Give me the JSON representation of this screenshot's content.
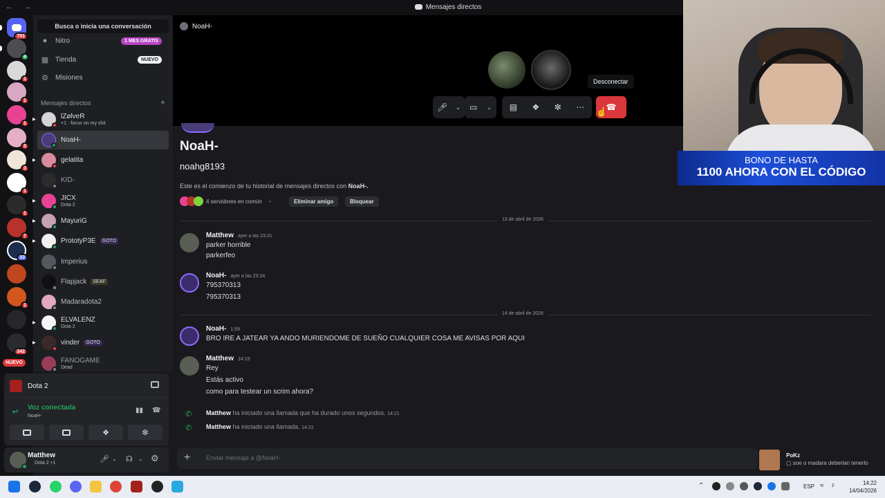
{
  "window": {
    "title": "Mensajes directos"
  },
  "sidebar": {
    "search_placeholder": "Busca o inicia una conversación",
    "nav": [
      {
        "label": "Nitro",
        "pill": "1 MES GRATIS"
      },
      {
        "label": "Tienda",
        "pill": "NUEVO"
      },
      {
        "label": "Misiones",
        "pill": ""
      }
    ],
    "dm_header": "Mensajes directos",
    "dms": [
      {
        "name": "lZølveR",
        "sub": "+1 · focus on my shit",
        "tag": ""
      },
      {
        "name": "NoaH-",
        "sub": "",
        "tag": ""
      },
      {
        "name": "gelatita",
        "sub": "",
        "tag": ""
      },
      {
        "name": "KID-",
        "sub": "",
        "tag": ""
      },
      {
        "name": "JICX",
        "sub": "Dota 2",
        "tag": ""
      },
      {
        "name": "MayuriG",
        "sub": "",
        "tag": ""
      },
      {
        "name": "PrototyP3E",
        "sub": "",
        "tag": "GOTO"
      },
      {
        "name": "Imperius",
        "sub": "",
        "tag": ""
      },
      {
        "name": "Flapjack",
        "sub": "",
        "tag": "SEAF"
      },
      {
        "name": "Madaradota2",
        "sub": "",
        "tag": ""
      },
      {
        "name": "ELVALENZ",
        "sub": "Dota 2",
        "tag": ""
      },
      {
        "name": "vinder",
        "sub": "",
        "tag": "GOTO"
      },
      {
        "name": "FANOGAME",
        "sub": "Dead",
        "tag": ""
      }
    ]
  },
  "servers": {
    "badges": [
      "791",
      "4",
      "1",
      "1",
      "1",
      "3",
      "3",
      "1",
      "1",
      "7",
      "33",
      "1",
      "342"
    ],
    "new_label": "NUEVO"
  },
  "activity": {
    "game": "Dota 2"
  },
  "voice": {
    "status": "Voz conectada",
    "channel": "NoaH-"
  },
  "user": {
    "name": "Matthew",
    "status": "Dota 2 +1"
  },
  "call": {
    "channel": "NoaH-",
    "tooltip": "Desconectar"
  },
  "profile": {
    "display_name": "NoaH-",
    "username": "noahg8193",
    "intro_prefix": "Este es el comienzo de tu historial de mensajes directos con ",
    "intro_name": "NoaH-.",
    "mutual": "4 servidores en común",
    "remove_friend": "Eliminar amigo",
    "block": "Bloquear"
  },
  "messages": {
    "date1": "13 de abril de 2026",
    "date2": "14 de abril de 2026",
    "m1": {
      "author": "Matthew",
      "time": "ayer a las 23:31",
      "lines": [
        "parker horrible",
        "parkerfeo"
      ]
    },
    "m2": {
      "author": "NoaH-",
      "time": "ayer a las 23:34",
      "lines": [
        "795370313",
        "795370313"
      ]
    },
    "m3": {
      "author": "NoaH-",
      "time": "1:59",
      "lines": [
        "BRO IRE A JATEAR YA ANDO MURIENDOME DE SUEÑO CUALQUIER COSA ME AVISAS POR AQUI"
      ]
    },
    "m4": {
      "author": "Matthew",
      "time": "14:19",
      "lines": [
        "Rey",
        "Estás activo",
        "como para testear un scrim ahora?"
      ]
    },
    "call1": {
      "author": "Matthew",
      "text": "ha iniciado una llamada que ha durado unos segundos.",
      "time": "14:21"
    },
    "call2": {
      "author": "Matthew",
      "text": "ha iniciado una llamada.",
      "time": "14:21"
    }
  },
  "composer": {
    "placeholder": "Enviar mensaje a @NoaH-"
  },
  "toast": {
    "name": "PoKz",
    "text": "soe o madara deberian tenerlo"
  },
  "overlay": {
    "line1": "BONO DE HASTA",
    "line2": "1100 AHORA CON EL CÓDIGO"
  },
  "taskbar": {
    "lang": "ESP",
    "time": "14:22",
    "date": "14/04/2026"
  },
  "colors": {
    "accent": "#5865f2",
    "danger": "#da373c",
    "online": "#23a55a"
  }
}
